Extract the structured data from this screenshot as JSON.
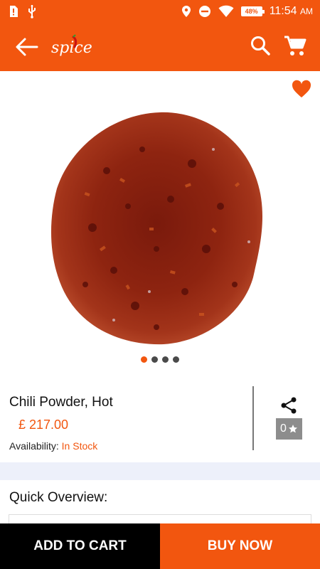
{
  "status_bar": {
    "time": "11:54",
    "time_suffix": "AM",
    "battery": "48%"
  },
  "app_bar": {
    "logo_text": "spice",
    "icons": [
      "back-arrow-icon",
      "search-icon",
      "cart-icon"
    ]
  },
  "product": {
    "name": "Chili Powder, Hot",
    "price": "£ 217.00",
    "availability_label": "Availability:",
    "availability_value": "In Stock",
    "rating": "0",
    "image_count": 4,
    "active_image": 1
  },
  "overview": {
    "title": "Quick Overview:"
  },
  "actions": {
    "add_to_cart": "ADD TO CART",
    "buy_now": "BUY NOW"
  },
  "colors": {
    "accent": "#f2560f",
    "dark": "#000000",
    "rating_bg": "#8d8d8d"
  }
}
